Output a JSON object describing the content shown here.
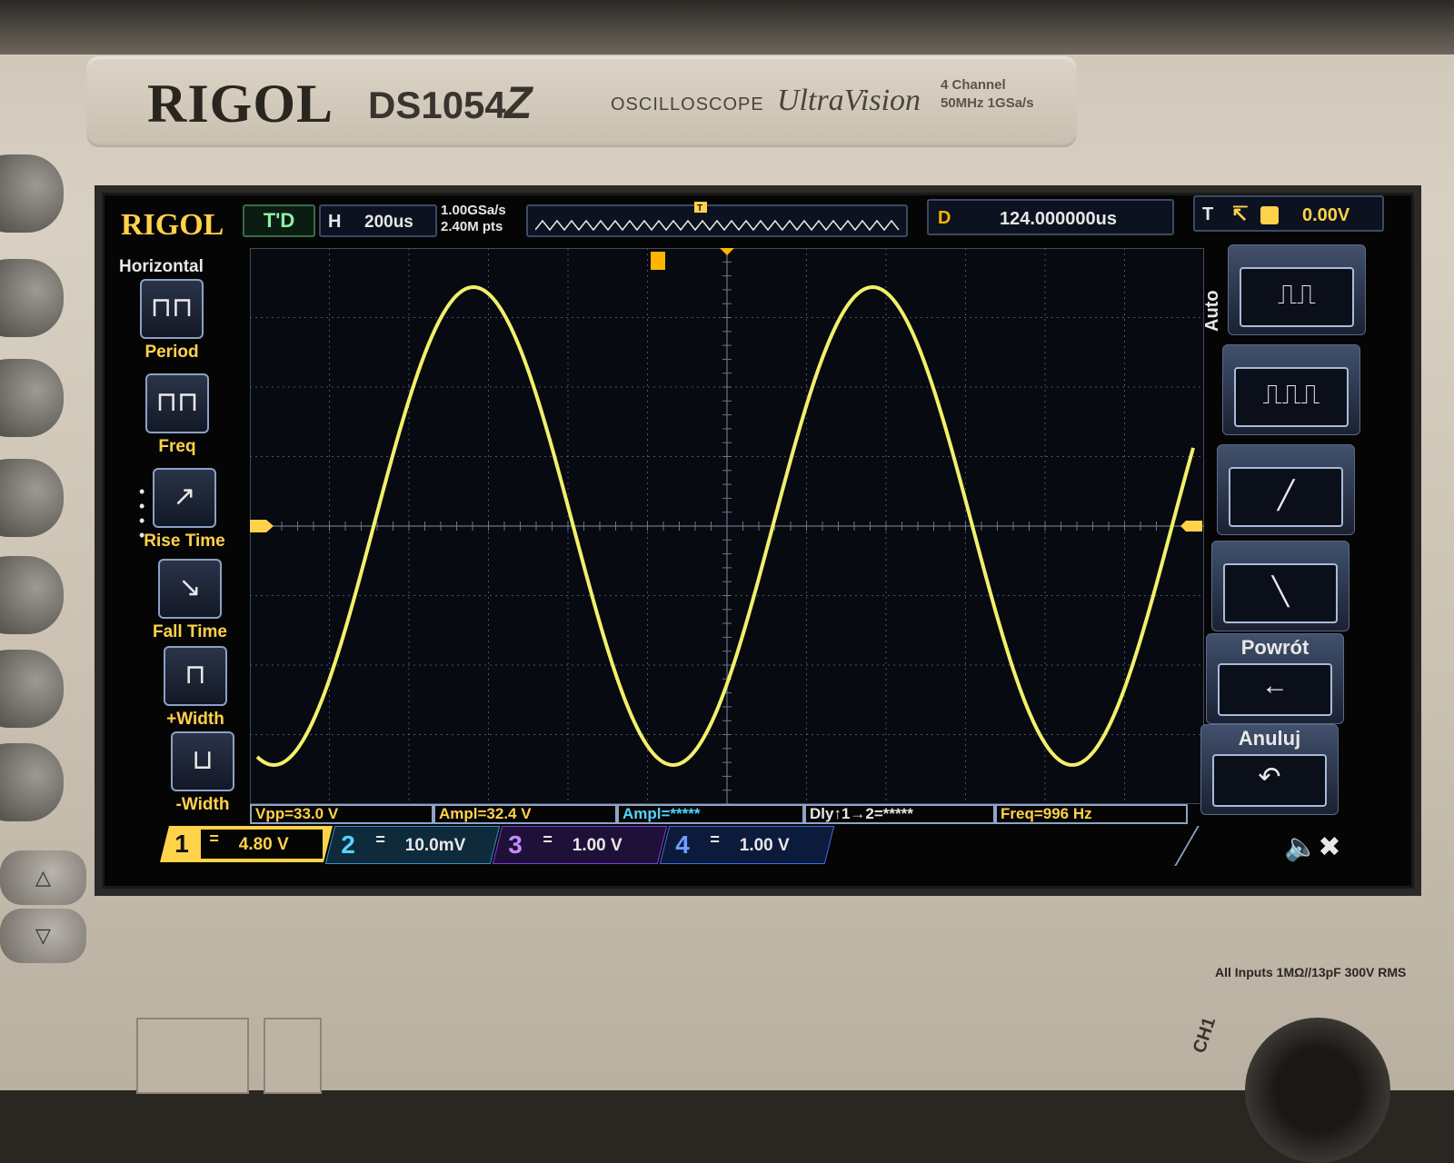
{
  "device": {
    "brand": "RIGOL",
    "model": "DS1054",
    "model_suffix": "Z",
    "type": "OSCILLOSCOPE",
    "series": "UltraVision",
    "spec_line1": "4 Channel",
    "spec_line2": "50MHz 1GSa/s",
    "inputs_note": "All Inputs 1MΩ//13pF 300V RMS",
    "channel_connector": "CH1"
  },
  "status_bar": {
    "logo": "RIGOL",
    "run_state": "T'D",
    "horizontal_letter": "H",
    "timebase": "200us",
    "sample_rate": "1.00GSa/s",
    "memory_depth": "2.40M pts",
    "delay_letter": "D",
    "delay": "124.000000us",
    "trigger_letter": "T",
    "trigger_edge_icon": "rising-edge-icon",
    "trigger_level": "0.00V",
    "trigger_color": "#ffd24a"
  },
  "left_menu": {
    "title": "Horizontal",
    "items": [
      {
        "label": "Period",
        "icon": "period-icon",
        "glyph": "⊓⊓",
        "highlight": true
      },
      {
        "label": "Freq",
        "icon": "freq-icon",
        "glyph": "⊓⊓",
        "highlight": true
      },
      {
        "label": "Rise Time",
        "icon": "rise-time-icon",
        "glyph": "↗",
        "highlight": true
      },
      {
        "label": "Fall Time",
        "icon": "fall-time-icon",
        "glyph": "↘",
        "highlight": true
      },
      {
        "label": "+Width",
        "icon": "pos-width-icon",
        "glyph": "⊓",
        "highlight": true
      },
      {
        "label": "-Width",
        "icon": "neg-width-icon",
        "glyph": "⊔",
        "highlight": true
      }
    ]
  },
  "right_menu": {
    "title": "Auto",
    "items": [
      {
        "label": "",
        "icon": "square-wave-icon",
        "glyph": "⎍⎍"
      },
      {
        "label": "",
        "icon": "pulse-train-icon",
        "glyph": "⎍⎍⎍"
      },
      {
        "label": "",
        "icon": "rising-edge-icon",
        "glyph": "╱"
      },
      {
        "label": "",
        "icon": "falling-edge-icon",
        "glyph": "╲"
      },
      {
        "label": "Powrót",
        "icon": "back-arrow-icon",
        "glyph": "←"
      },
      {
        "label": "Anuluj",
        "icon": "undo-icon",
        "glyph": "↶"
      }
    ]
  },
  "measurements": [
    {
      "text": "Vpp=33.0 V",
      "color": "yellow"
    },
    {
      "text": "Ampl=32.4 V",
      "color": "yellow"
    },
    {
      "text": "Ampl=*****",
      "color": "cyan"
    },
    {
      "text": "Dly↑1→2=*****",
      "color": "white"
    },
    {
      "text": "Freq=996 Hz",
      "color": "yellow"
    }
  ],
  "channels": [
    {
      "number": "1",
      "coupling": "=",
      "scale": "4.80 V",
      "color": "#ffd24a"
    },
    {
      "number": "2",
      "coupling": "=",
      "scale": "10.0mV",
      "color": "#4fd7ff"
    },
    {
      "number": "3",
      "coupling": "=",
      "scale": "1.00 V",
      "color": "#c38bff"
    },
    {
      "number": "4",
      "coupling": "=",
      "scale": "1.00 V",
      "color": "#6f9dff"
    }
  ],
  "speaker_icon": "speaker-muted-icon",
  "chart_data": {
    "type": "line",
    "title": "",
    "xlabel": "",
    "ylabel": "",
    "x_divisions": 12,
    "y_divisions": 8,
    "grid": true,
    "series": [
      {
        "color": "#f2f06a",
        "waveform": "sine",
        "frequency_hz": 996,
        "amplitude_vpp": 33.0,
        "volts_per_div": 4.8,
        "time_per_div_us": 200
      }
    ]
  }
}
